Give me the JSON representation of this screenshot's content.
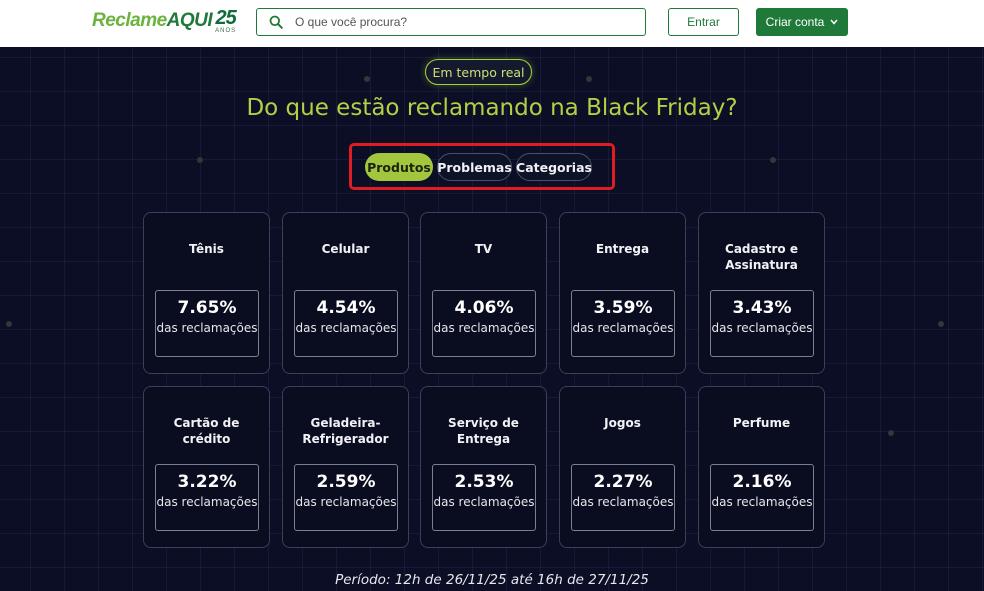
{
  "header": {
    "logo": {
      "reclame": "Reclame",
      "aqui": "AQUI",
      "anniversary": "25",
      "anos": "ANOS"
    },
    "search": {
      "placeholder": "O que você procura?",
      "value": ""
    },
    "login_label": "Entrar",
    "signup_label": "Criar conta"
  },
  "hero": {
    "badge": "Em tempo real",
    "headline": "Do que estão reclamando na Black Friday?",
    "tabs": [
      {
        "label": "Produtos",
        "active": true
      },
      {
        "label": "Problemas",
        "active": false
      },
      {
        "label": "Categorias",
        "active": false
      }
    ],
    "cards": [
      {
        "title": "Tênis",
        "percent": "7.65%",
        "caption": "das reclamações"
      },
      {
        "title": "Celular",
        "percent": "4.54%",
        "caption": "das reclamações"
      },
      {
        "title": "TV",
        "percent": "4.06%",
        "caption": "das reclamações"
      },
      {
        "title": "Entrega",
        "percent": "3.59%",
        "caption": "das reclamações"
      },
      {
        "title": "Cadastro e Assinatura",
        "percent": "3.43%",
        "caption": "das reclamações"
      },
      {
        "title": "Cartão de crédito",
        "percent": "3.22%",
        "caption": "das reclamações"
      },
      {
        "title": "Geladeira-Refrigerador",
        "percent": "2.59%",
        "caption": "das reclamações"
      },
      {
        "title": "Serviço de Entrega",
        "percent": "2.53%",
        "caption": "das reclamações"
      },
      {
        "title": "Jogos",
        "percent": "2.27%",
        "caption": "das reclamações"
      },
      {
        "title": "Perfume",
        "percent": "2.16%",
        "caption": "das reclamações"
      }
    ],
    "period": "Período: 12h de 26/11/25 até 16h de 27/11/25"
  },
  "colors": {
    "brand_green": "#1f7a3a",
    "accent_lime": "#a3c63f",
    "background": "#0b0e24",
    "highlight_red": "#e01c23"
  },
  "icons": {
    "search": "search-icon",
    "chevron": "chevron-down-icon"
  }
}
